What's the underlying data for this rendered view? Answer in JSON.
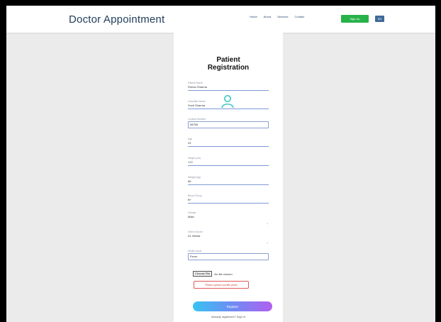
{
  "navbar": {
    "brand": "Doctor Appointment",
    "links": [
      "Home",
      "About",
      "Services",
      "Contact"
    ],
    "signup_label": "Sign Up",
    "lang_label": "EN"
  },
  "form": {
    "title_line1": "Patient",
    "title_line2": "Registration",
    "fields": [
      {
        "label": "Patient Name",
        "value": "Rohan Sharma"
      },
      {
        "label": "Guardian Name",
        "value": "Sunil Sharma"
      },
      {
        "label": "Contact Number",
        "value": "98765"
      },
      {
        "label": "Age",
        "value": "24"
      },
      {
        "label": "Height (cm)",
        "value": "172"
      },
      {
        "label": "Weight (kg)",
        "value": "68"
      },
      {
        "label": "Blood Group",
        "value": "B+"
      },
      {
        "label": "Gender",
        "value": "Male"
      },
      {
        "label": "Select Doctor",
        "value": "Dr. Mehta"
      },
      {
        "label": "Health Issue",
        "value": "Fever"
      }
    ],
    "file_button": "Choose File",
    "file_status": "No file chosen",
    "error_text": "Please upload a profile photo",
    "register_label": "Register",
    "signin_text": "Already registered? Sign in"
  }
}
